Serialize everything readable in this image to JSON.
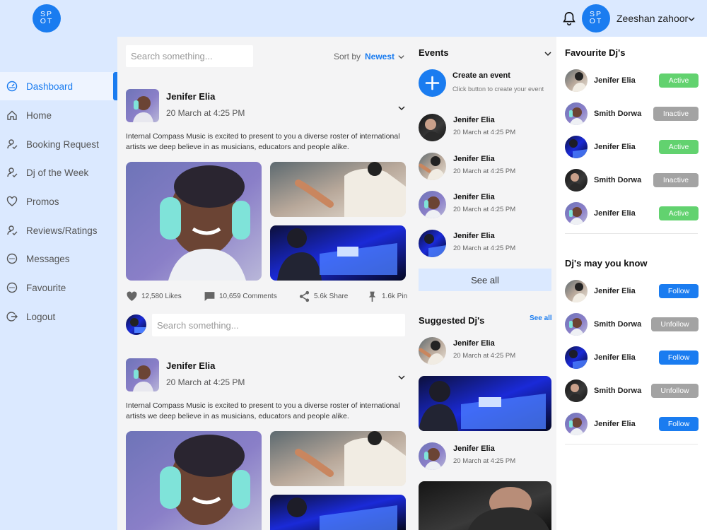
{
  "brand": {
    "logo_top": "SP",
    "logo_bottom": "OT"
  },
  "user": {
    "name": "Zeeshan zahoor",
    "logo_top": "SP",
    "logo_bottom": "OT"
  },
  "sidebar": {
    "items": [
      {
        "label": "Dashboard",
        "icon": "dashboard-icon",
        "active": true
      },
      {
        "label": "Home",
        "icon": "home-icon"
      },
      {
        "label": "Booking Request",
        "icon": "user-check-icon"
      },
      {
        "label": "Dj of the Week",
        "icon": "user-check-icon"
      },
      {
        "label": "Promos",
        "icon": "heart-icon"
      },
      {
        "label": "Reviews/Ratings",
        "icon": "user-check-icon"
      },
      {
        "label": "Messages",
        "icon": "chat-icon"
      },
      {
        "label": "Favourite",
        "icon": "chat-icon"
      },
      {
        "label": "Logout",
        "icon": "logout-icon"
      }
    ]
  },
  "feed": {
    "search_placeholder": "Search something...",
    "sort_label": "Sort by",
    "sort_value": "Newest",
    "posts": [
      {
        "author": "Jenifer Elia",
        "time": "20 March at 4:25 PM",
        "text": "Internal Compass Music is excited to present to you a diverse roster of international artists we deep believe in as musicians, educators and people alike.",
        "likes": "12,580 Likes",
        "comments": "10,659 Comments",
        "shares": "5.6k Share",
        "pins": "1.6k Pin"
      },
      {
        "author": "Jenifer Elia",
        "time": "20 March at 4:25 PM",
        "text": "Internal Compass Music is excited to present to you a diverse roster of international artists we deep believe in as musicians, educators and people alike."
      }
    ],
    "comment_placeholder": "Search something..."
  },
  "events": {
    "title": "Events",
    "create_title": "Create an event",
    "create_desc": "Click button to create your event",
    "items": [
      {
        "name": "Jenifer Elia",
        "time": "20 March at 4:25 PM"
      },
      {
        "name": "Jenifer Elia",
        "time": "20 March at 4:25 PM"
      },
      {
        "name": "Jenifer Elia",
        "time": "20 March at 4:25 PM"
      },
      {
        "name": "Jenifer Elia",
        "time": "20 March at 4:25 PM"
      }
    ],
    "see_all": "See all"
  },
  "suggested": {
    "title": "Suggested Dj's",
    "see_all": "See all",
    "items": [
      {
        "name": "Jenifer Elia",
        "time": "20 March at 4:25 PM"
      },
      {
        "name": "Jenifer Elia",
        "time": "20 March at 4:25 PM"
      }
    ]
  },
  "favourites": {
    "title": "Favourite Dj's",
    "items": [
      {
        "name": "Jenifer Elia",
        "status": "Active"
      },
      {
        "name": "Smith Dorwa",
        "status": "Inactive"
      },
      {
        "name": "Jenifer Elia",
        "status": "Active"
      },
      {
        "name": "Smith Dorwa",
        "status": "Inactive"
      },
      {
        "name": "Jenifer Elia",
        "status": "Active"
      }
    ]
  },
  "may_know": {
    "title": "Dj's may you know",
    "items": [
      {
        "name": "Jenifer Elia",
        "action": "Follow"
      },
      {
        "name": "Smith Dorwa",
        "action": "Unfollow"
      },
      {
        "name": "Jenifer Elia",
        "action": "Follow"
      },
      {
        "name": "Smith Dorwa",
        "action": "Unfollow"
      },
      {
        "name": "Jenifer Elia",
        "action": "Follow"
      }
    ]
  },
  "colors": {
    "accent": "#1a7cf0",
    "sidebar_bg": "#dbe9ff",
    "active_green": "#62d26f",
    "neutral_gray": "#a3a3a3"
  }
}
